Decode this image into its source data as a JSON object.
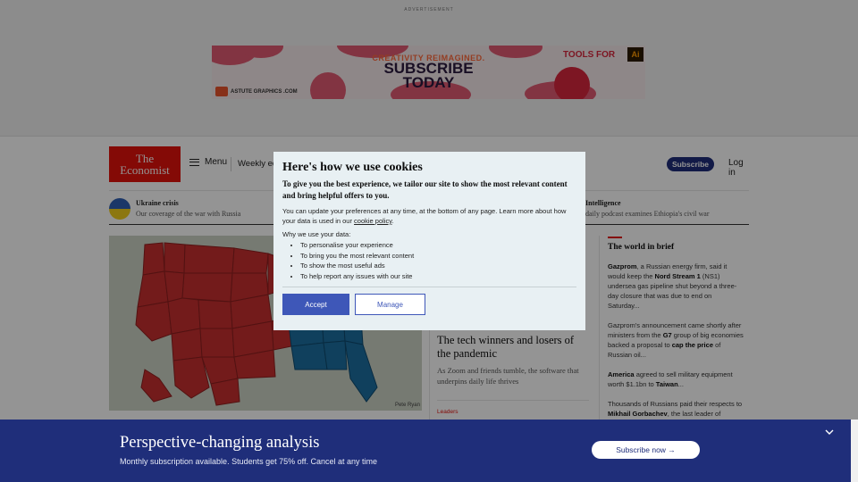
{
  "ad": {
    "label": "ADVERTISEMENT",
    "tagline": "CREATIVITY REIMAGINED.",
    "headline_line1": "SUBSCRIBE",
    "headline_line2": "TODAY",
    "tools_text": "TOOLS FOR",
    "ai_badge": "Ai",
    "brand": "ASTUTE GRAPHICS .COM"
  },
  "header": {
    "logo_line1": "The",
    "logo_line2": "Economist",
    "menu_label": "Menu",
    "weekly_label": "Weekly ed",
    "subscribe_label": "Subscribe",
    "login_label": "Log in"
  },
  "topics": [
    {
      "title": "Ukraine crisis",
      "subtitle": "Our coverage of the war with Russia"
    },
    {
      "title": "Intelligence",
      "subtitle": "daily podcast examines Ethiopia's civil war"
    }
  ],
  "main": {
    "map_credit": "Pete Ryan",
    "lead_kicker": "",
    "lead_headline": "The tech winners and losers of the pandemic",
    "lead_description": "As Zoom and friends tumble, the software that underpins daily life thrives",
    "lead_tag": "Leaders"
  },
  "brief": {
    "title": "The world in brief",
    "items": [
      {
        "lead": "Gazprom",
        "text1": ", a Russian energy firm, said it would keep the ",
        "bold2": "Nord Stream 1",
        "text2": " (NS1) undersea gas pipeline shut beyond a three-day closure that was due to end on Saturday..."
      },
      {
        "lead": "",
        "text1": "Gazprom's announcement came shortly after ministers from the ",
        "bold2": "G7",
        "text2": " group of big economies backed a proposal to ",
        "bold3": "cap the price",
        "text3": " of Russian oil..."
      },
      {
        "lead": "America",
        "text1": " agreed to sell military equipment worth $1.1bn to ",
        "bold2": "Taiwan",
        "text2": "..."
      },
      {
        "lead": "",
        "text1": "Thousands of Russians paid their respects to ",
        "bold2": "Mikhail Gorbachev",
        "text2": ", the last leader of"
      }
    ]
  },
  "cookie": {
    "title": "Here's how we use cookies",
    "intro": "To give you the best experience, we tailor our site to show the most relevant content and bring helpful offers to you.",
    "text_before_link": "You can update your preferences at any time, at the bottom of any page. Learn more about how your data is used in our ",
    "link_text": "cookie policy",
    "text_after_link": ".",
    "why_label": "Why we use your data:",
    "reasons": [
      "To personalise your experience",
      "To bring you the most relevant content",
      "To show the most useful ads",
      "To help report any issues with our site"
    ],
    "accept_label": "Accept",
    "manage_label": "Manage"
  },
  "promo": {
    "headline": "Perspective-changing analysis",
    "subtext": "Monthly subscription available. Students get 75% off. Cancel at any time",
    "button_label": "Subscribe now →"
  },
  "colors": {
    "brand_red": "#e3120b",
    "navy": "#1f2e7a",
    "accept_blue": "#3e57b8",
    "map_red": "#c6302f",
    "map_blue": "#1c6fa0"
  }
}
